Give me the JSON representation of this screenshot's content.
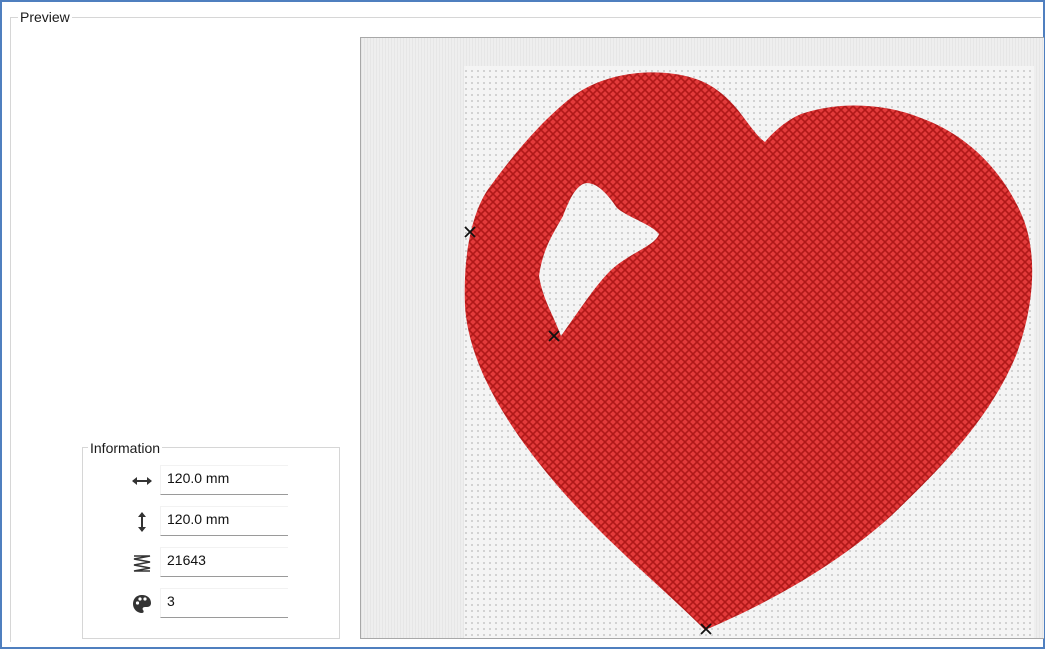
{
  "preview": {
    "title": "Preview"
  },
  "information": {
    "title": "Information",
    "rows": [
      {
        "icon": "width-arrows-icon",
        "value": "120.0 mm"
      },
      {
        "icon": "height-arrows-icon",
        "value": "120.0 mm"
      },
      {
        "icon": "stitch-count-icon",
        "value": "21643"
      },
      {
        "icon": "color-palette-icon",
        "value": "3"
      }
    ]
  },
  "colors": {
    "frame_border": "#4f7fbf",
    "stitch_red": "#d42020",
    "stitch_red_dark": "#b01818",
    "fabric_background": "#eeeeee",
    "grid_dot": "#c8c8c8",
    "jump_marker": "#111111"
  }
}
